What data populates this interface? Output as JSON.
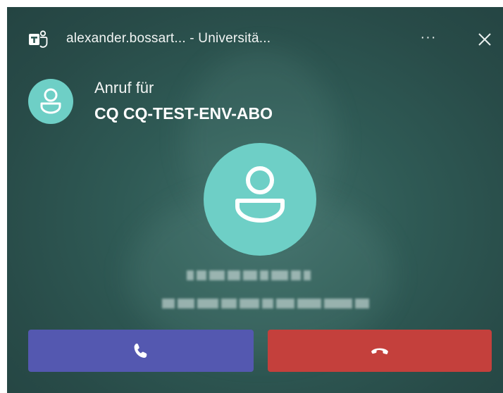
{
  "window": {
    "title": "alexander.bossart... - Universitä...",
    "more_label": "···"
  },
  "caller": {
    "call_for_label": "Anruf für",
    "target_name": "CQ CQ-TEST-ENV-ABO"
  },
  "actions": {
    "accept_icon": "phone-icon",
    "decline_icon": "hang-up-icon"
  },
  "colors": {
    "background": "#2f5a55",
    "avatar": "#6ecfc6",
    "accept": "#5458b0",
    "decline": "#c4403c"
  }
}
